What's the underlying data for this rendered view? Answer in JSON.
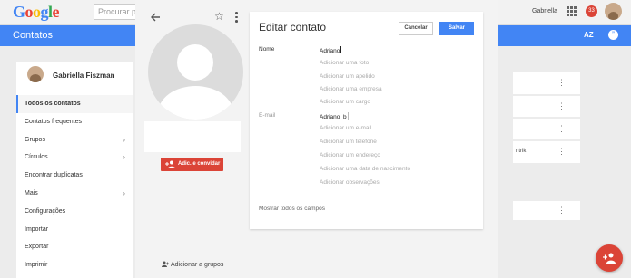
{
  "topbar": {
    "logo": "Google",
    "search_placeholder": "Procurar pe",
    "user_name": "Gabriella",
    "notification_count": "33"
  },
  "header": {
    "app_title": "Contatos",
    "sort_label": "AZ"
  },
  "sidebar": {
    "user_name": "Gabriella Fiszman",
    "items": [
      {
        "label": "Todos os contatos",
        "active": true,
        "chevron": false
      },
      {
        "label": "Contatos frequentes",
        "active": false,
        "chevron": false
      },
      {
        "label": "Grupos",
        "active": false,
        "chevron": true
      },
      {
        "label": "Círculos",
        "active": false,
        "chevron": true
      },
      {
        "label": "Encontrar duplicatas",
        "active": false,
        "chevron": false
      },
      {
        "label": "Mais",
        "active": false,
        "chevron": true
      },
      {
        "label": "Configurações",
        "active": false,
        "chevron": false
      },
      {
        "label": "Importar",
        "active": false,
        "chevron": false
      },
      {
        "label": "Exportar",
        "active": false,
        "chevron": false
      },
      {
        "label": "Imprimir",
        "active": false,
        "chevron": false
      }
    ]
  },
  "background": {
    "partial_text": "ntrik"
  },
  "contact": {
    "add_invite_label": "Adic. e convidar",
    "add_groups_label": "Adicionar a grupos"
  },
  "edit": {
    "title": "Editar contato",
    "cancel_label": "Cancelar",
    "save_label": "Salvar",
    "name_label": "Nome",
    "name_value": "Adriano",
    "name_options": [
      "Adicionar uma foto",
      "Adicionar um apelido",
      "Adicionar uma empresa",
      "Adicionar um cargo"
    ],
    "email_label": "E-mail",
    "email_value": "Adriano_b",
    "email_options": [
      "Adicionar um e-mail",
      "Adicionar um telefone",
      "Adicionar um endereço",
      "Adicionar uma data de nascimento",
      "Adicionar observações"
    ],
    "show_all_label": "Mostrar todos os campos"
  }
}
